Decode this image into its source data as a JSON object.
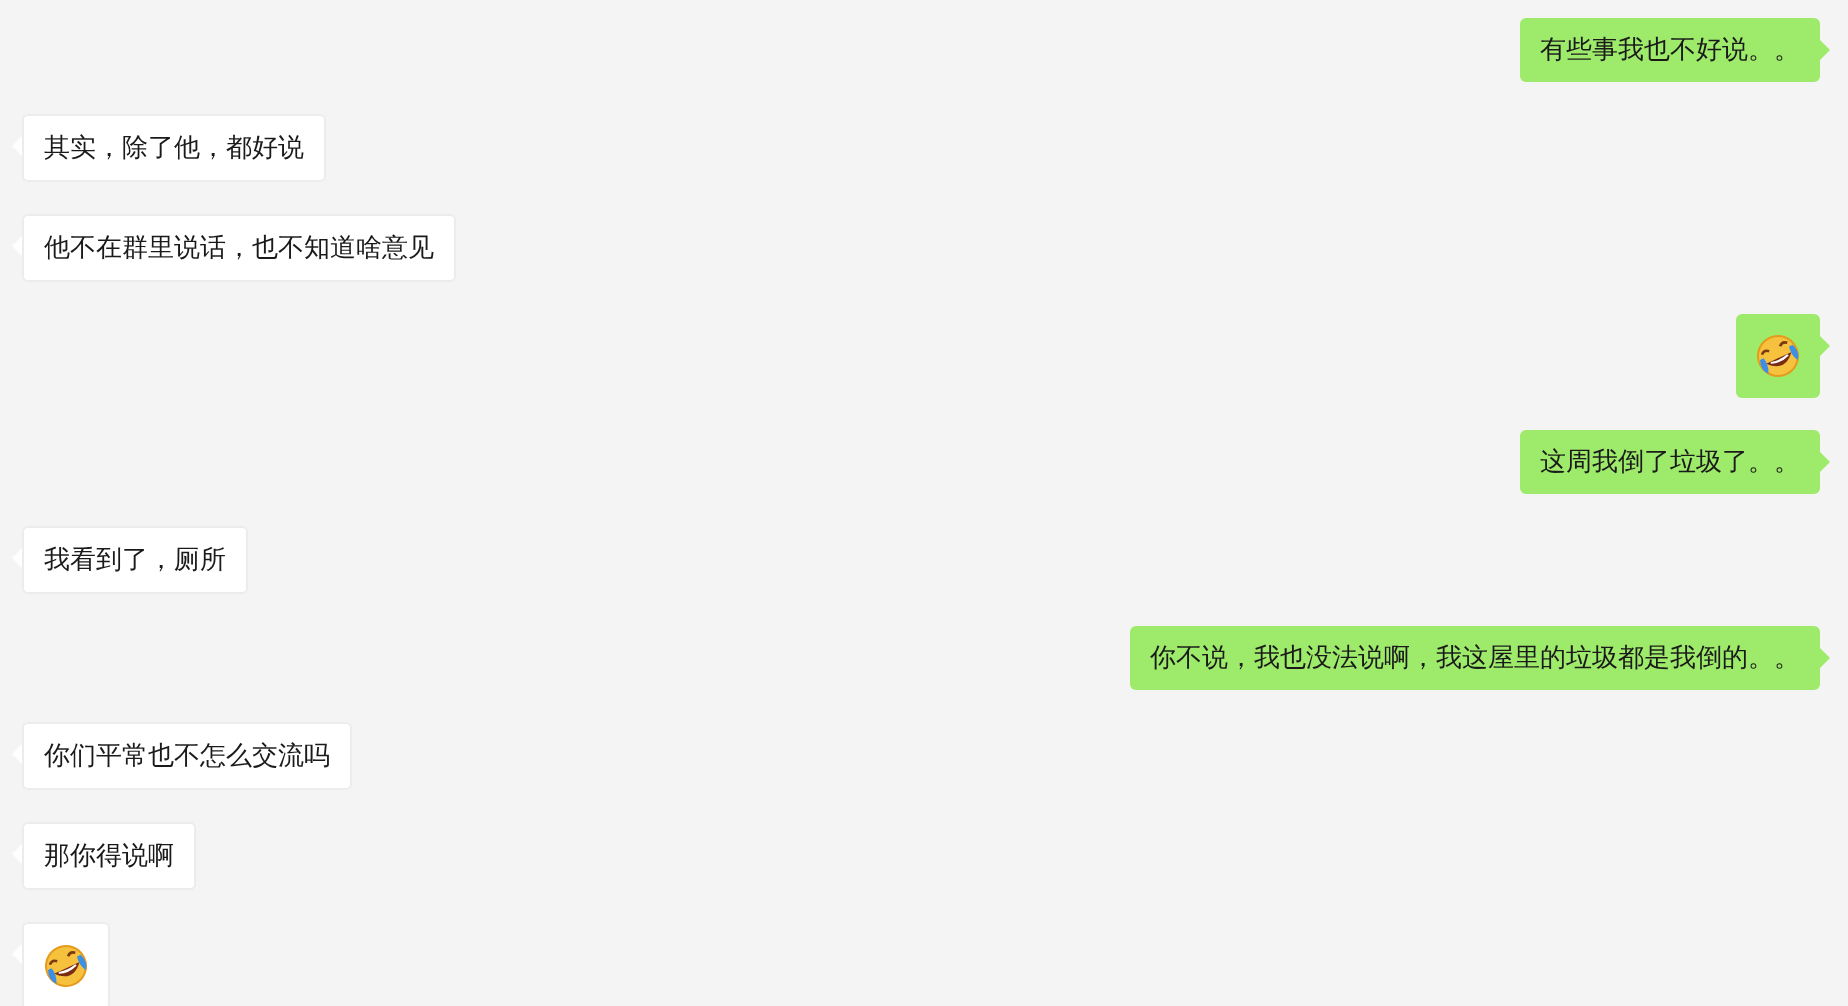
{
  "messages": [
    {
      "outgoing": true,
      "kind": "text",
      "text": "有些事我也不好说。。"
    },
    {
      "outgoing": false,
      "kind": "text",
      "text": "其实，除了他，都好说"
    },
    {
      "outgoing": false,
      "kind": "text",
      "text": "他不在群里说话，也不知道啥意见"
    },
    {
      "outgoing": true,
      "kind": "emoji"
    },
    {
      "outgoing": true,
      "kind": "text",
      "text": "这周我倒了垃圾了。。"
    },
    {
      "outgoing": false,
      "kind": "text",
      "text": "我看到了，厕所"
    },
    {
      "outgoing": true,
      "kind": "text",
      "text": "你不说，我也没法说啊，我这屋里的垃圾都是我倒的。。"
    },
    {
      "outgoing": false,
      "kind": "text",
      "text": "你们平常也不怎么交流吗"
    },
    {
      "outgoing": false,
      "kind": "text",
      "text": "那你得说啊"
    },
    {
      "outgoing": false,
      "kind": "emoji"
    }
  ]
}
